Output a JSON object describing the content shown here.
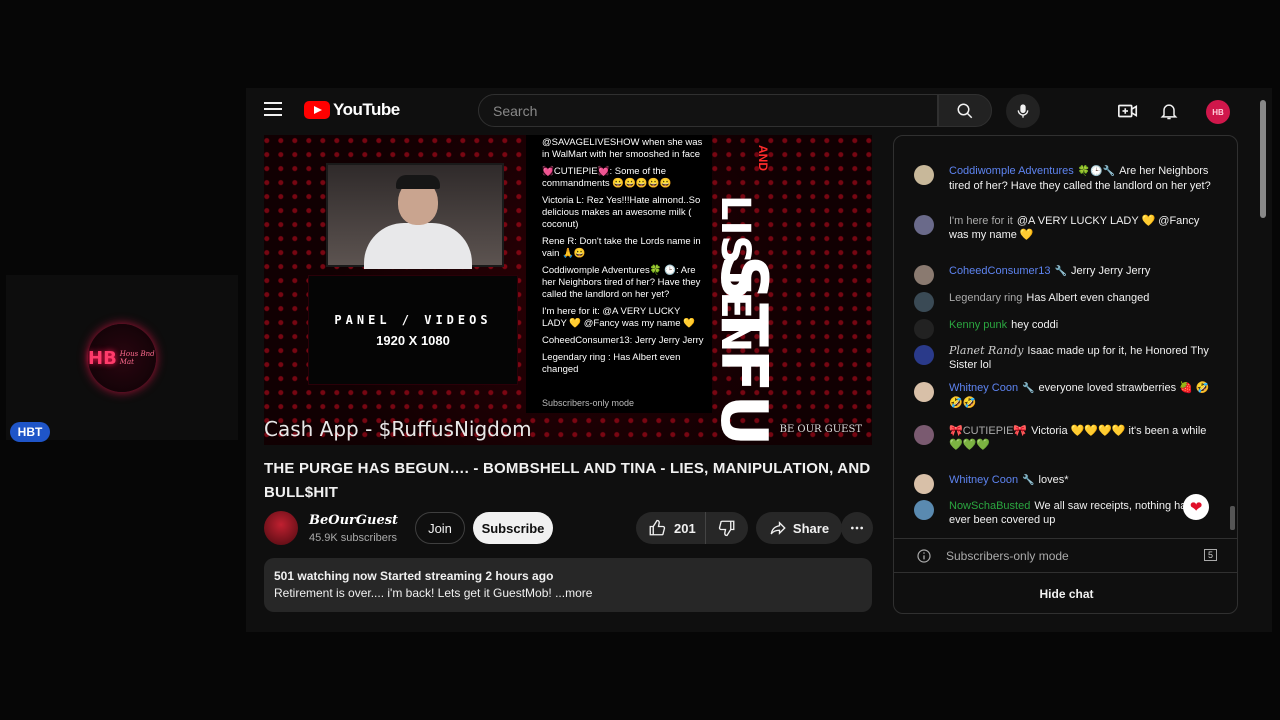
{
  "overlay": {
    "logo_mono": "HB",
    "logo_script": "Hous Bnd Mat",
    "badge": "HBT"
  },
  "topbar": {
    "brand": "YouTube",
    "search_placeholder": "Search",
    "avatar_text": "HB"
  },
  "player": {
    "panel_line1": "PANEL / VIDEOS",
    "panel_line2": "1920 X 1080",
    "overlay_chat": [
      "@SAVAGELIVESHOW when she was in WalMart with her smooshed in face",
      "💓CUTIEPIE💓: Some of the commandments 😀😀😀😀😀",
      "Victoria L: Rez Yes!!!Hate almond..So delicious makes an awesome milk ( coconut)",
      "Rene R: Don't take the Lords name in vain 🙏😀",
      "Coddiwomple Adventures🍀 🕒: Are her Neighbors tired of her? Have they called the landlord on her yet?",
      "I'm here for it: @A VERY LUCKY LADY 💛 @Fancy was my name 💛",
      "CoheedConsumer13: Jerry Jerry Jerry",
      "Legendary ring : Has Albert even changed"
    ],
    "overlay_footer": "Subscribers-only mode",
    "stfu": "STFU",
    "and": "AND",
    "listen": "LISTEN",
    "be_our_guest": "BE OUR GUEST",
    "cashapp": "Cash App - $RuffusNigdom"
  },
  "video": {
    "title": "THE PURGE HAS BEGUN…. - BOMBSHELL AND TINA - LIES, MANIPULATION, AND BULL$HIT",
    "channel": "BeOurGuest",
    "subscribers": "45.9K subscribers",
    "join_label": "Join",
    "subscribe_label": "Subscribe",
    "likes": "201",
    "share_label": "Share",
    "stats": "501 watching now  Started streaming 2 hours ago",
    "description": "Retirement is over.... i'm back! Lets get it GuestMob! ...more"
  },
  "chat": {
    "messages": [
      {
        "name": "Coddiwomple Adventures",
        "badges": "🍀🕒🔧",
        "text": "Are her Neighbors tired of her? Have they called the landlord on her yet?",
        "color": "blue"
      },
      {
        "name": "I'm here for it",
        "badges": "",
        "text": "@A VERY LUCKY LADY 💛 @Fancy was my name 💛",
        "color": "gray"
      },
      {
        "name": "CoheedConsumer13",
        "badges": "🔧",
        "text": "Jerry Jerry Jerry",
        "color": "blue"
      },
      {
        "name": "Legendary ring",
        "badges": "",
        "text": "Has Albert even changed",
        "color": "gray"
      },
      {
        "name": "Kenny punk",
        "badges": "",
        "text": "hey coddi",
        "color": "green"
      },
      {
        "name": "Planet Randy",
        "badges": "",
        "text": "Isaac made up for it, he Honored Thy Sister lol",
        "color": "italic"
      },
      {
        "name": "Whitney Coon",
        "badges": "🔧",
        "text": "everyone loved strawberries 🍓 🤣🤣🤣",
        "color": "blue"
      },
      {
        "name": "🎀CUTIEPIE🎀",
        "badges": "",
        "text": "Victoria 💛💛💛💛 it's been a while💚💚💚",
        "color": "gray"
      },
      {
        "name": "Whitney Coon",
        "badges": "🔧",
        "text": "loves*",
        "color": "blue"
      },
      {
        "name": "NowSchaBusted",
        "badges": "",
        "text": "We all saw receipts, nothing has ever been covered up",
        "color": "green"
      }
    ],
    "mode": "Subscribers-only mode",
    "count": "5",
    "hide_label": "Hide chat",
    "heart": "❤"
  }
}
